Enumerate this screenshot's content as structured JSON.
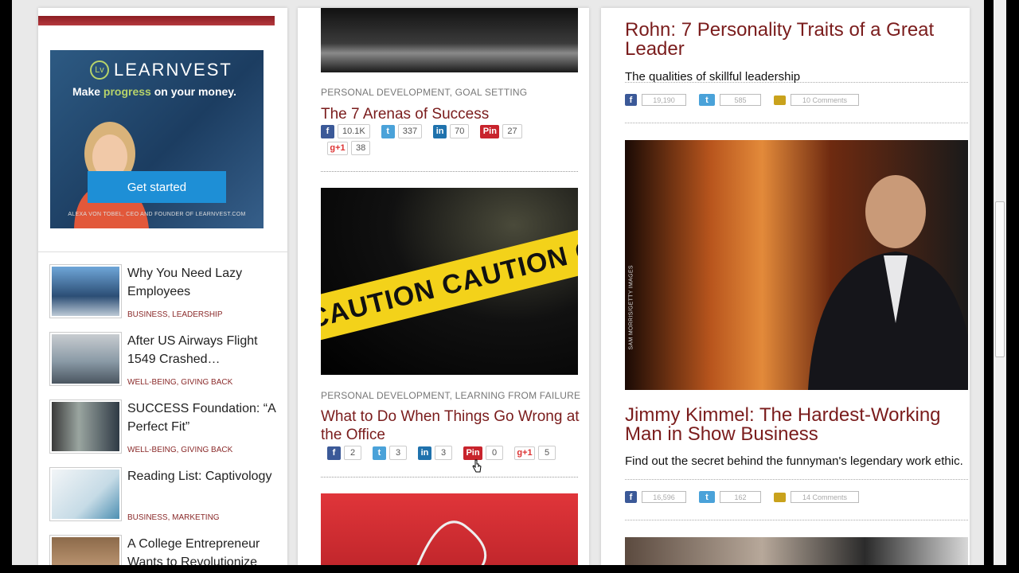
{
  "sidebar": {
    "ad": {
      "brand_mark": "Lv",
      "brand": "LEARNVEST",
      "tagline_pre": "Make ",
      "tagline_highlight": "progress",
      "tagline_post": " on your money.",
      "cta": "Get started",
      "credit": "ALEXA VON TOBEL, CEO AND FOUNDER OF LEARNVEST.COM"
    },
    "items": [
      {
        "title": "Why You Need Lazy Employees",
        "cats": "BUSINESS, LEADERSHIP"
      },
      {
        "title": "After US Airways Flight 1549 Crashed…",
        "cats": "WELL-BEING, GIVING BACK"
      },
      {
        "title": "SUCCESS Foundation: “A Perfect Fit”",
        "cats": "WELL-BEING, GIVING BACK"
      },
      {
        "title": "Reading List: Captivology",
        "cats": "BUSINESS, MARKETING"
      },
      {
        "title": "A College Entrepreneur Wants to Revolutionize",
        "cats": ""
      }
    ]
  },
  "middle": {
    "articles": [
      {
        "cats": "PERSONAL DEVELOPMENT, GOAL SETTING",
        "title": "The 7 Arenas of Success",
        "counts": {
          "facebook": "10.1K",
          "twitter": "337",
          "linkedin": "70",
          "pinterest": "27",
          "gplus": "38"
        }
      },
      {
        "image_text": "CAUTION CAUTION CAUTIO",
        "cats": "PERSONAL DEVELOPMENT, LEARNING FROM FAILURE",
        "title": "What to Do When Things Go Wrong at the Office",
        "counts": {
          "facebook": "2",
          "twitter": "3",
          "linkedin": "3",
          "pinterest": "0",
          "gplus": "5"
        }
      }
    ],
    "share_icons": {
      "facebook": "f",
      "twitter": "t",
      "linkedin": "in",
      "pinterest": "Pin",
      "gplus": "g+1"
    }
  },
  "right": {
    "posts": [
      {
        "title": "Rohn: 7 Personality Traits of a Great Leader",
        "subtitle": "The qualities of skillful leadership",
        "counts": {
          "facebook": "19,190",
          "twitter": "585",
          "comments": "10 Comments"
        }
      },
      {
        "image_credit": "SAM MORRIS/GETTY IMAGES",
        "title": "Jimmy Kimmel: The Hardest-Working Man in Show Business",
        "subtitle": "Find out the secret behind the funnyman's legendary work ethic.",
        "counts": {
          "facebook": "16,596",
          "twitter": "162",
          "comments": "14 Comments"
        }
      }
    ]
  },
  "colors": {
    "accent": "#7a1c1c",
    "facebook": "#3b5998",
    "twitter": "#4aa2d9",
    "linkedin": "#1f72ad",
    "pinterest": "#c8232c"
  }
}
